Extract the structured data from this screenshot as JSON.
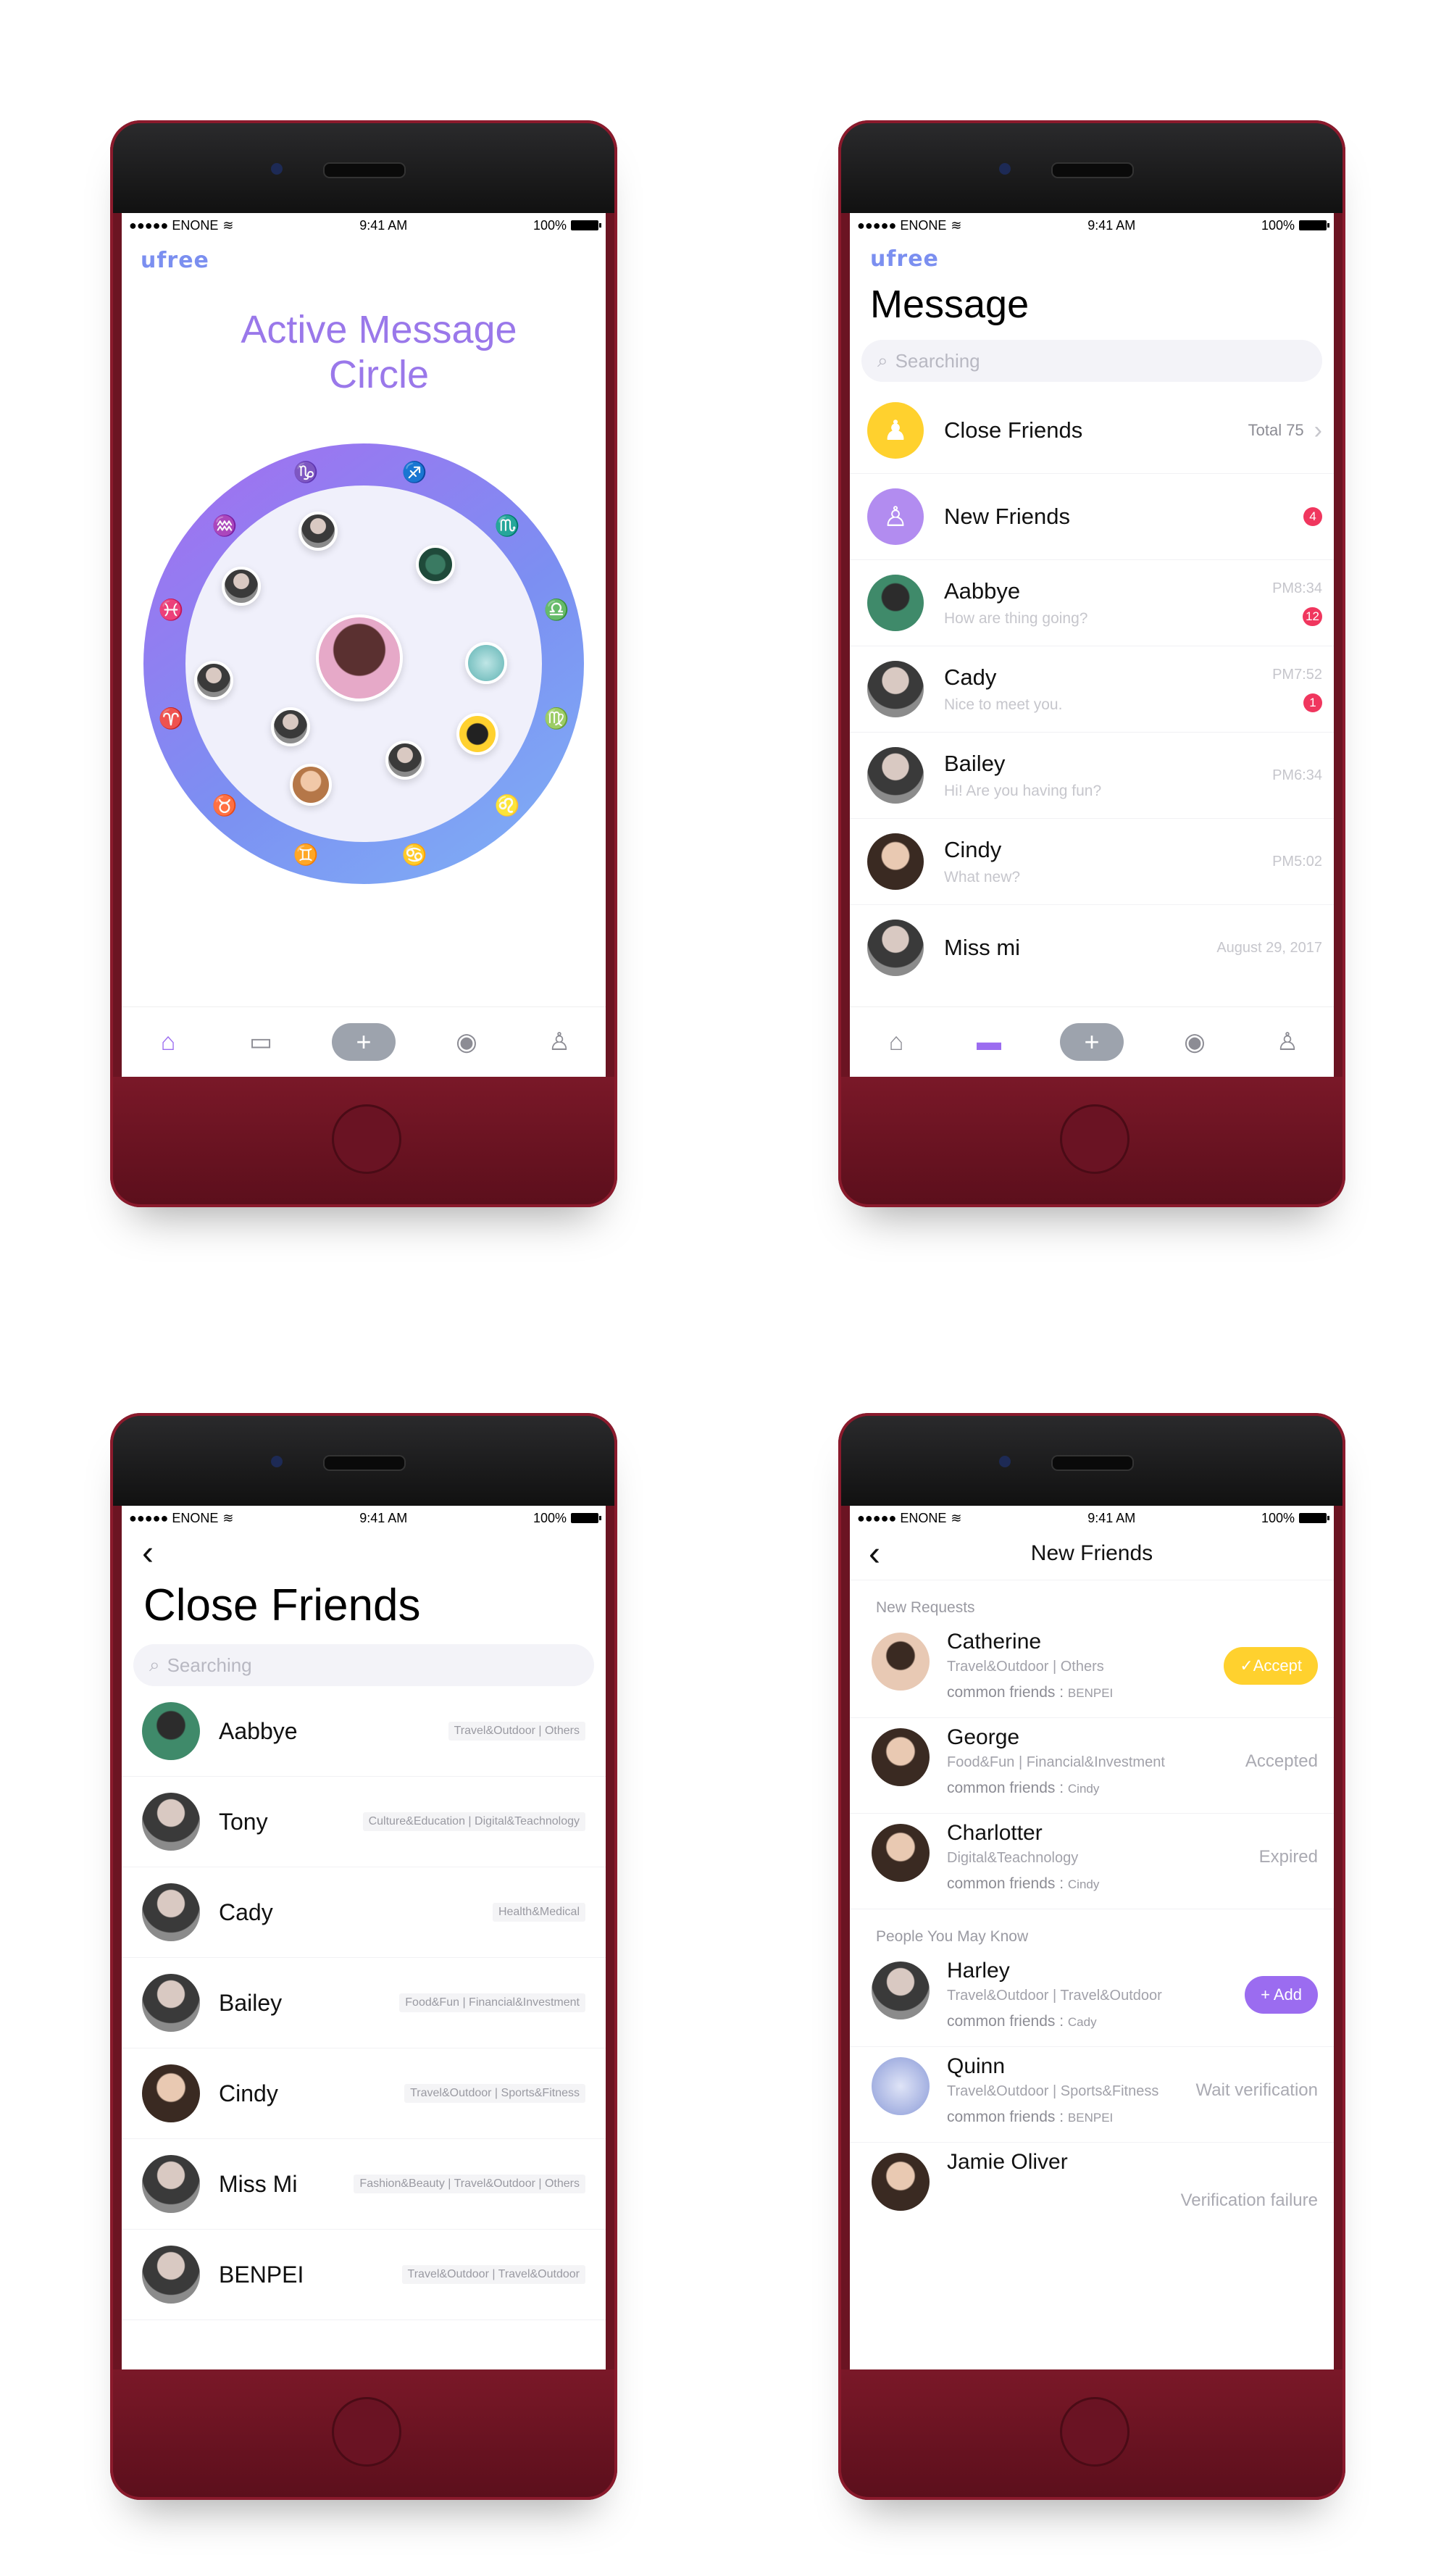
{
  "status": {
    "carrier": "●●●●● ENONE",
    "time": "9:41 AM",
    "battery": "100%"
  },
  "brand": {
    "logo": "ufree"
  },
  "colors": {
    "accent": "#9b6cf0",
    "brand": "#7b8ff0",
    "alert": "#f0365e",
    "yellow": "#ffd12e",
    "phone_body": "#6b1422"
  },
  "tabbar": {
    "icons": [
      "home-icon",
      "chat-icon",
      "plus-icon",
      "compass-icon",
      "profile-icon"
    ],
    "plus": "+"
  },
  "screen1": {
    "title": "Active Message Circle",
    "zodiac": [
      "♑",
      "♐",
      "♏",
      "♎",
      "♍",
      "♌",
      "♋",
      "♊",
      "♉",
      "♈",
      "♓",
      "♒"
    ]
  },
  "screen2": {
    "title": "Message",
    "search_placeholder": "Searching",
    "close_friends": {
      "label": "Close Friends",
      "total": "Total 75",
      "chevron": "›"
    },
    "new_friends": {
      "label": "New Friends",
      "badge": "4"
    },
    "messages": [
      {
        "name": "Aabbye",
        "preview": "How are thing going?",
        "time": "PM8:34",
        "badge": "12"
      },
      {
        "name": "Cady",
        "preview": "Nice to meet you.",
        "time": "PM7:52",
        "badge": "1"
      },
      {
        "name": "Bailey",
        "preview": "Hi! Are you having fun?",
        "time": "PM6:34",
        "badge": ""
      },
      {
        "name": "Cindy",
        "preview": "What new?",
        "time": "PM5:02",
        "badge": ""
      },
      {
        "name": "Miss mi",
        "preview": "",
        "time": "August 29, 2017",
        "badge": ""
      }
    ]
  },
  "screen3": {
    "back": "‹",
    "title": "Close Friends",
    "search_placeholder": "Searching",
    "friends": [
      {
        "name": "Aabbye",
        "tags": "Travel&Outdoor | Others"
      },
      {
        "name": "Tony",
        "tags": "Culture&Education | Digital&Teachnology"
      },
      {
        "name": "Cady",
        "tags": "Health&Medical"
      },
      {
        "name": "Bailey",
        "tags": "Food&Fun | Financial&Investment"
      },
      {
        "name": "Cindy",
        "tags": "Travel&Outdoor | Sports&Fitness"
      },
      {
        "name": "Miss Mi",
        "tags": "Fashion&Beauty | Travel&Outdoor | Others"
      },
      {
        "name": "BENPEI",
        "tags": "Travel&Outdoor | Travel&Outdoor"
      }
    ]
  },
  "screen4": {
    "back": "‹",
    "title": "New Friends",
    "section_requests": "New Requests",
    "section_people": "People You May Know",
    "common_label": "common friends : ",
    "requests": [
      {
        "name": "Catherine",
        "cats": "Travel&Outdoor | Others",
        "common": "BENPEI",
        "action": "✓Accept"
      },
      {
        "name": "George",
        "cats": "Food&Fun | Financial&Investment",
        "common": "Cindy",
        "action": "Accepted"
      },
      {
        "name": "Charlotter",
        "cats": "Digital&Teachnology",
        "common": "Cindy",
        "action": "Expired"
      }
    ],
    "people": [
      {
        "name": "Harley",
        "cats": "Travel&Outdoor | Travel&Outdoor",
        "common": "Cady",
        "action": "+ Add"
      },
      {
        "name": "Quinn",
        "cats": "Travel&Outdoor | Sports&Fitness",
        "common": "BENPEI",
        "action": "Wait verification"
      },
      {
        "name": "Jamie Oliver",
        "cats": "",
        "common": "",
        "action": "Verification failure"
      }
    ]
  }
}
